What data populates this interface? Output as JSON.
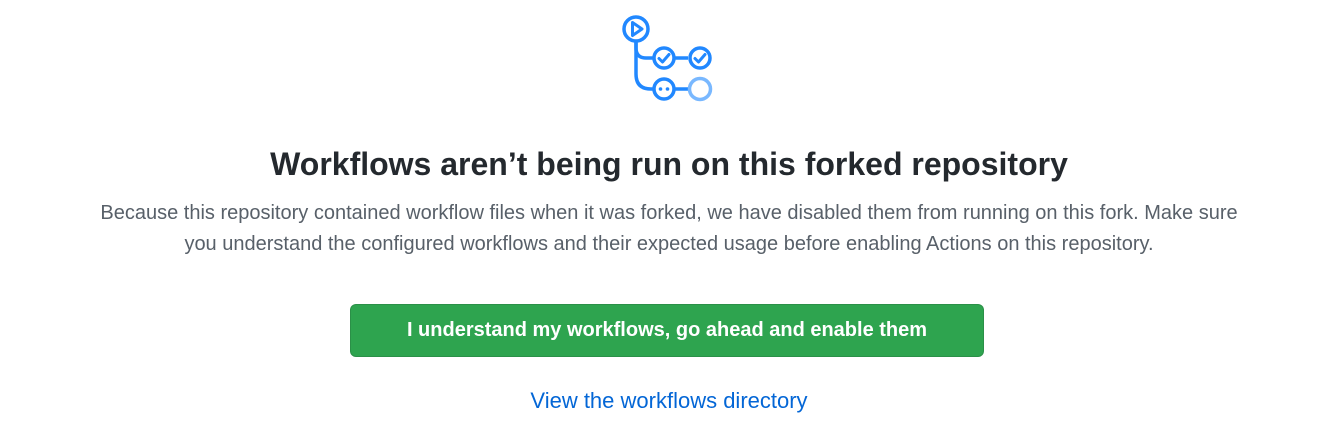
{
  "illustration": {
    "icon": "workflows-illustration-icon",
    "accent": "#2188ff",
    "accent_light": "#79b8ff"
  },
  "blankslate": {
    "title": "Workflows aren’t being run on this forked repository",
    "description_line1": "Because this repository contained workflow files when it was forked, we have disabled them from running on this fork. Make sure",
    "description_line2": "you understand the configured workflows and their expected usage before enabling Actions on this repository.",
    "enable_button_label": "I understand my workflows, go ahead and enable them",
    "directory_link_label": "View the workflows directory"
  },
  "colors": {
    "button_green": "#2ea44f",
    "link_blue": "#0366d6",
    "title_text": "#24292e",
    "muted_text": "#586069"
  }
}
